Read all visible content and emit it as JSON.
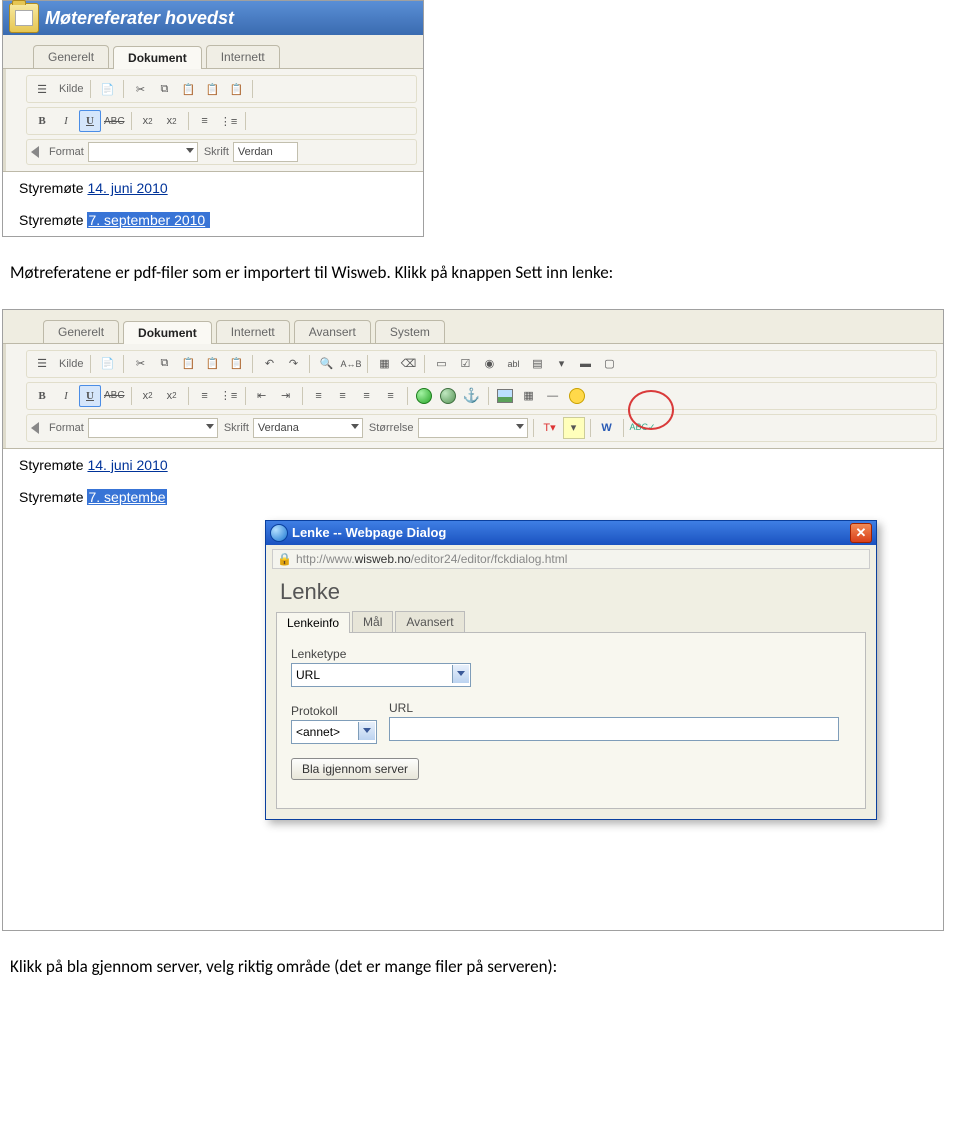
{
  "app1": {
    "title_part": "Møtereferater hovedst",
    "tabs": [
      "Generelt",
      "Dokument",
      "Internett"
    ],
    "toolbar": {
      "kilde": "Kilde",
      "format": "Format",
      "skrift": "Skrift",
      "font_value": "Verdan"
    },
    "content": {
      "line1_label": "Styremøte ",
      "line1_link": "14. juni 2010",
      "line2_label": "Styremøte ",
      "line2_link": "7. september 2010"
    }
  },
  "para1": "Møtreferatene er pdf-filer som er importert til Wisweb. Klikk på knappen Sett inn lenke:",
  "app2": {
    "tabs": [
      "Generelt",
      "Dokument",
      "Internett",
      "Avansert",
      "System"
    ],
    "toolbar": {
      "kilde": "Kilde",
      "format": "Format",
      "skrift": "Skrift",
      "font_value": "Verdana",
      "storrelse": "Størrelse"
    },
    "content": {
      "line1_label": "Styremøte ",
      "line1_link": "14. juni 2010",
      "line2_label": "Styremøte ",
      "line2_link_a": "7. septembe"
    }
  },
  "dialog": {
    "title": "Lenke -- Webpage Dialog",
    "url_prefix": "http://www.",
    "url_host": "wisweb.no",
    "url_rest": "/editor24/editor/fckdialog.html",
    "heading": "Lenke",
    "tabs": [
      "Lenkeinfo",
      "Mål",
      "Avansert"
    ],
    "lenketype_label": "Lenketype",
    "lenketype_value": "URL",
    "protokoll_label": "Protokoll",
    "protokoll_value": "<annet>",
    "url_label": "URL",
    "browse_button": "Bla igjennom server"
  },
  "para2": "Klikk på bla gjennom server, velg riktig område (det er mange filer på serveren):"
}
